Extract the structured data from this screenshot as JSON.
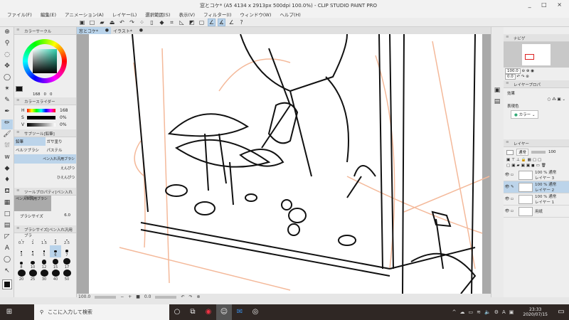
{
  "window": {
    "title": "窓とコケ* (A5 4134 x 2913px 500dpi 100.0%) - CLIP STUDIO PAINT PRO",
    "controls": "_ □ ×"
  },
  "menu": [
    "ファイル(F)",
    "編集(E)",
    "アニメーション(A)",
    "レイヤー(L)",
    "選択範囲(S)",
    "表示(V)",
    "フィルター(I)",
    "ウィンドウ(W)",
    "ヘルプ(H)"
  ],
  "tabs": [
    {
      "label": "窓とコケ*",
      "close": "●"
    },
    {
      "label": "イラスト*",
      "close": "●"
    }
  ],
  "color_circle": {
    "title": "カラーサークル",
    "h": "168",
    "s": "0",
    "v": "0",
    "accent": "#2bd3b0"
  },
  "color_slider": {
    "title": "カラースライダー",
    "rows": [
      {
        "label": "H",
        "value": "168"
      },
      {
        "label": "S",
        "value": "0%"
      },
      {
        "label": "V",
        "value": "0%"
      }
    ]
  },
  "subtool": {
    "title": "サブツール[鉛筆]",
    "tabs": [
      "鉛筆",
      "ガサ塗り",
      "ベルツブラシ",
      "パステル"
    ],
    "brushes": [
      "ペン入れ汎用ブラシ",
      "えんぴつ",
      "ひえんぴつ"
    ]
  },
  "tool_property": {
    "title": "ツールプロパティ[ペン入れ汎用]",
    "brush_name": "ペン入れ汎用ブラシ",
    "brush_size_label": "ブラシサイズ",
    "brush_size": "6.0"
  },
  "brush_size_panel": {
    "title": "ブラシサイズ[ペン入れ汎用ブラ",
    "sizes": [
      "0.7",
      "1",
      "1.5",
      "2",
      "2.5",
      "3",
      "4",
      "5",
      "6",
      "7",
      "8",
      "10",
      "12",
      "15",
      "17",
      "20",
      "25",
      "30",
      "40",
      "50"
    ],
    "selected": "6"
  },
  "status": {
    "zoom": "100.0",
    "angle": "0.0"
  },
  "navigator": {
    "title": "ナビゲ",
    "zoom": "100.0",
    "angle": "0.0"
  },
  "layer_property": {
    "title": "レイヤープロパ",
    "effect_label": "効果",
    "color_label": "表現色",
    "color_value": "カラー"
  },
  "layers": {
    "title": "レイヤー",
    "blend": "通常",
    "opacity": "100",
    "items": [
      {
        "mode": "100 % 通常",
        "name": "レイヤー 3"
      },
      {
        "mode": "100 % 通常",
        "name": "レイヤー 2",
        "selected": true
      },
      {
        "mode": "100 % 通常",
        "name": "レイヤー 1"
      },
      {
        "mode": "",
        "name": "用紙"
      }
    ]
  },
  "taskbar": {
    "search_placeholder": "ここに入力して検索",
    "time": "23:33",
    "date": "2020/07/15"
  }
}
